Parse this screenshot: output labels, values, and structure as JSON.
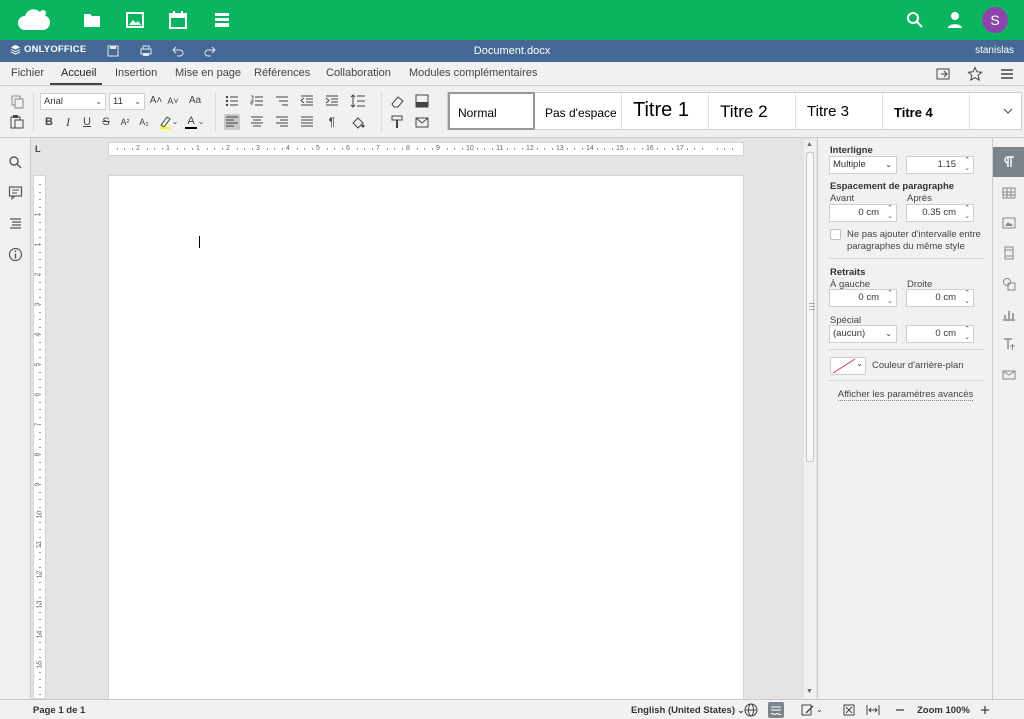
{
  "nextcloud": {
    "icons": [
      "logo-cloud-icon",
      "files-icon",
      "photos-icon",
      "calendar-icon",
      "deck-icon",
      "search-icon",
      "contacts-icon"
    ],
    "avatar_letter": "S"
  },
  "editor": {
    "brand": "ONLYOFFICE",
    "document_title": "Document.docx",
    "user": "stanislas"
  },
  "menu": {
    "tabs": [
      "Fichier",
      "Accueil",
      "Insertion",
      "Mise en page",
      "Références",
      "Collaboration",
      "Modules complémentaires"
    ],
    "active": "Accueil"
  },
  "toolbar": {
    "font_name": "Arial",
    "font_size": "11",
    "styles": [
      "Normal",
      "Pas d'espace",
      "Titre 1",
      "Titre 2",
      "Titre 3",
      "Titre 4"
    ],
    "selected_style": "Normal",
    "bold": "B",
    "italic": "I",
    "underline": "U",
    "strike": "S",
    "superscript": "A²",
    "subscript": "A₂",
    "font_color": "A",
    "grow": "A˄",
    "shrink": "A˅",
    "case": "Aa"
  },
  "ruler": {
    "h_numbers": [
      "2",
      "1",
      "1",
      "2",
      "3",
      "4",
      "5",
      "6",
      "7",
      "8",
      "9",
      "10",
      "11",
      "12",
      "13",
      "14",
      "15",
      "16",
      "17"
    ],
    "v_numbers": [
      "1",
      "1",
      "2",
      "3",
      "4",
      "5",
      "6",
      "7",
      "8",
      "9",
      "10",
      "11",
      "12",
      "13",
      "14",
      "15"
    ],
    "corner": "L"
  },
  "panel": {
    "line_spacing_title": "Interligne",
    "line_spacing_mode": "Multiple",
    "line_spacing_value": "1.15",
    "para_spacing_title": "Espacement de paragraphe",
    "before_label": "Avant",
    "before_value": "0 cm",
    "after_label": "Après",
    "after_value": "0.35 cm",
    "no_interval_label_1": "Ne pas ajouter d'intervalle entre",
    "no_interval_label_2": "paragraphes du même style",
    "indents_title": "Retraits",
    "left_label": "À gauche",
    "left_value": "0 cm",
    "right_label": "Droite",
    "right_value": "0 cm",
    "special_label": "Spécial",
    "special_value": "(aucun)",
    "special_amount": "0 cm",
    "background_label": "Couleur d'arrière-plan",
    "advanced_link": "Afficher les paramètres avancés"
  },
  "status": {
    "page_info": "Page 1 de 1",
    "language": "English (United States)",
    "zoom": "Zoom 100%"
  },
  "colors": {
    "nextcloud_green": "#0ab55f",
    "onlyoffice_blue": "#446995",
    "avatar": "#8e44ad"
  }
}
